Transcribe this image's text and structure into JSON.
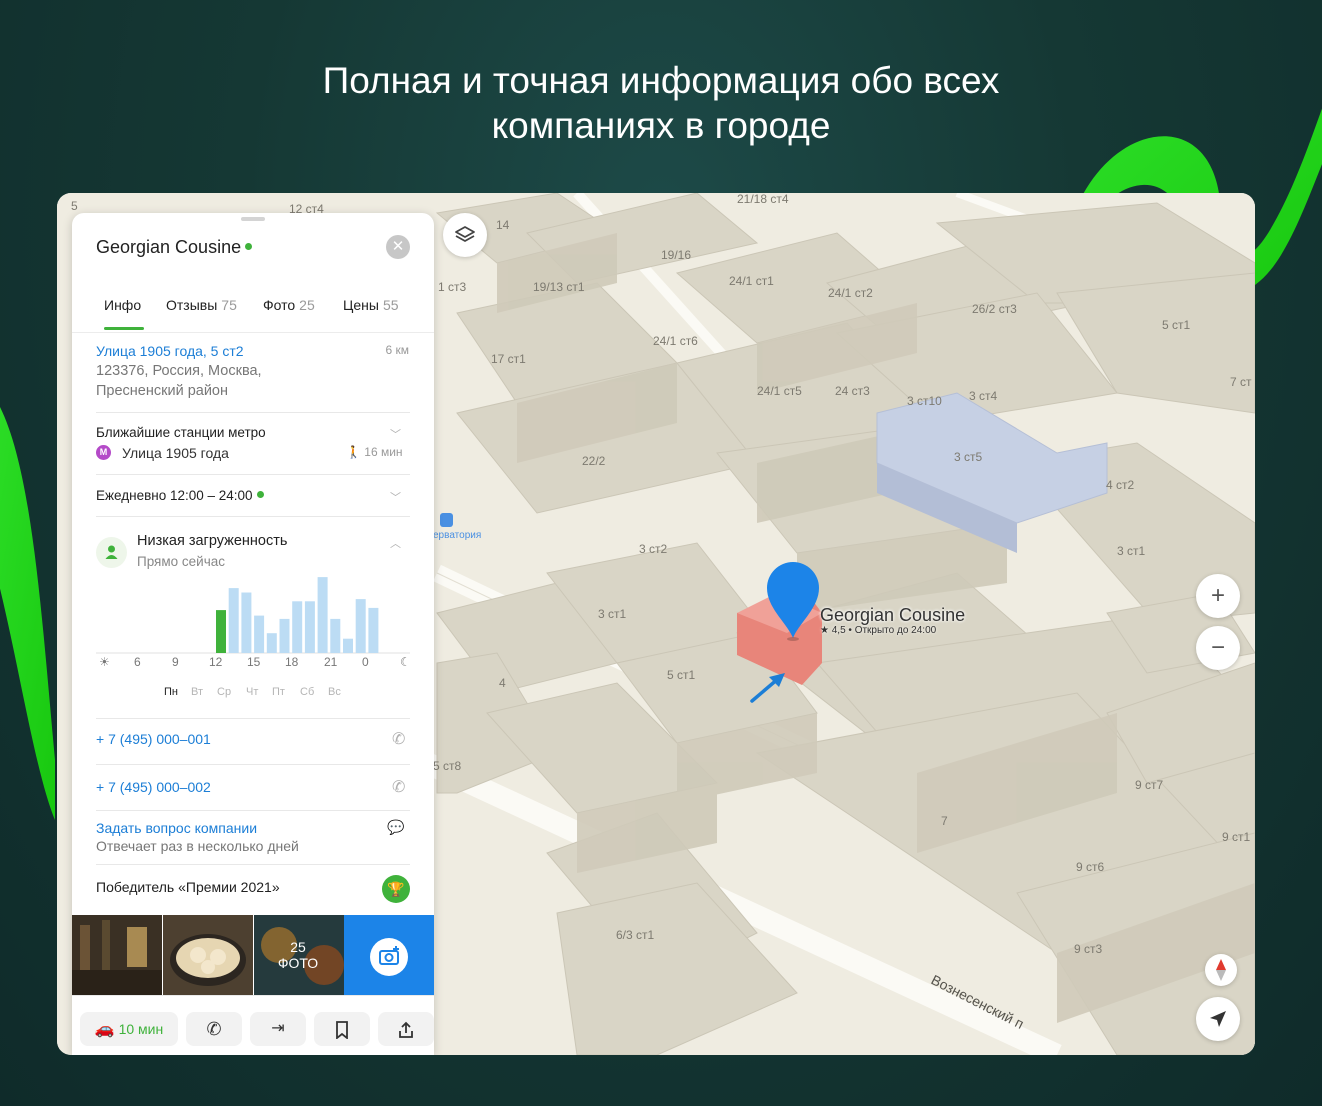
{
  "headline": {
    "line1": "Полная и точная информация обо всех",
    "line2": "компаниях в городе"
  },
  "colors": {
    "accent_green": "#3fb23b",
    "link_blue": "#1c7ed6",
    "metro_purple": "#b44ac8",
    "pin_blue": "#1c84e8",
    "building_highlight": "#e8857a"
  },
  "panel": {
    "title": "Georgian Cousine",
    "tabs": [
      {
        "label": "Инфо",
        "count": ""
      },
      {
        "label": "Отзывы",
        "count": "75"
      },
      {
        "label": "Фото",
        "count": "25"
      },
      {
        "label": "Цены",
        "count": "55"
      }
    ],
    "address": {
      "street": "Улица 1905 года, 5 ст2",
      "distance": "6 км",
      "line2": "123376, Россия, Москва,",
      "line3": "Пресненский район"
    },
    "metro": {
      "title": "Ближайшие станции метро",
      "icon_letter": "M",
      "station": "Улица 1905 года",
      "walk_time": "16 мин"
    },
    "hours": "Ежедневно 12:00 – 24:00",
    "busyness": {
      "title": "Низкая загруженность",
      "subtitle": "Прямо сейчас",
      "hour_ticks": [
        "6",
        "9",
        "12",
        "15",
        "18",
        "21",
        "0"
      ],
      "days": [
        "Пн",
        "Вт",
        "Ср",
        "Чт",
        "Пт",
        "Сб",
        "Вс"
      ],
      "active_day": "Пн"
    },
    "phones": [
      "+ 7 (495) 000–001",
      "+ 7 (495) 000–002"
    ],
    "ask": {
      "link": "Задать вопрос компании",
      "subtitle": "Отвечает раз в несколько дней"
    },
    "award": "Победитель «Премии 2021»",
    "photos": {
      "count": "25",
      "label": "ФОТО"
    },
    "toolbar": {
      "drive_time": "10 мин"
    }
  },
  "map": {
    "pin_name": "Georgian Cousine",
    "pin_sub": "★ 4,5  •  Открыто до 24:00",
    "street": "Вознесенский п",
    "poi_label": "ерватория",
    "labels": [
      "12 ст4",
      "14",
      "19/16",
      "21/18 ст4",
      "1 ст3",
      "19/13 ст1",
      "24/1 ст1",
      "24/1 ст2",
      "26/2 ст3",
      "5 ст1",
      "17 ст1",
      "24/1 ст6",
      "24/1 ст5",
      "24 ст3",
      "3 ст10",
      "3 ст4",
      "7 ст",
      "22/2",
      "3 ст5",
      "4 ст2",
      "3 ст1",
      "3 ст2",
      "3 ст1",
      "5 ст1",
      "4",
      "5 ст8",
      "7",
      "9 ст7",
      "9 ст6",
      "9 ст1",
      "6/3 ст1",
      "9 ст3",
      "5"
    ]
  },
  "busyness_chart": {
    "type": "bar",
    "categories": [
      "11",
      "12",
      "13",
      "14",
      "15",
      "16",
      "17",
      "18",
      "19",
      "20",
      "21",
      "22",
      "23"
    ],
    "values": [
      0.39,
      0.59,
      0.55,
      0.34,
      0.18,
      0.31,
      0.47,
      0.47,
      0.69,
      0.31,
      0.13,
      0.49,
      0.41
    ],
    "highlight_index": 0
  },
  "chart_data": {
    "type": "bar",
    "categories": [
      "11",
      "12",
      "13",
      "14",
      "15",
      "16",
      "17",
      "18",
      "19",
      "20",
      "21",
      "22",
      "23"
    ],
    "values": [
      0.39,
      0.59,
      0.55,
      0.34,
      0.18,
      0.31,
      0.47,
      0.47,
      0.69,
      0.31,
      0.13,
      0.49,
      0.41
    ]
  }
}
